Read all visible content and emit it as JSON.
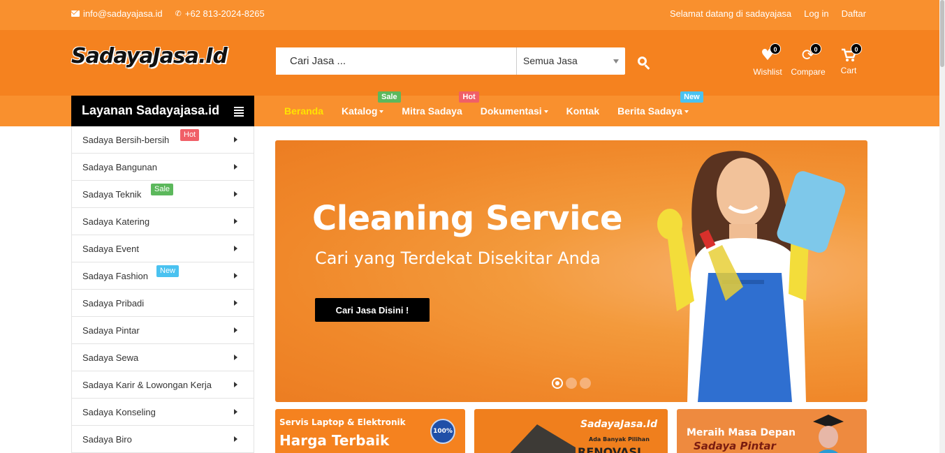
{
  "topbar": {
    "email": "info@sadayajasa.id",
    "phone": "+62 813-2024-8265",
    "welcome": "Selamat datang di sadayajasa",
    "login": "Log in",
    "register": "Daftar"
  },
  "header": {
    "logo": "SadayaJasa.Id",
    "search_placeholder": "Cari Jasa ...",
    "category_select": "Semua Jasa",
    "icons": [
      {
        "label": "Wishlist",
        "count": "0",
        "icon": "heart-icon"
      },
      {
        "label": "Compare",
        "count": "0",
        "icon": "refresh-icon"
      },
      {
        "label": "Cart",
        "count": "0",
        "icon": "cart-icon"
      }
    ]
  },
  "nav": {
    "category_title": "Layanan Sadayajasa.id",
    "items": [
      {
        "label": "Beranda"
      },
      {
        "label": "Katalog",
        "tag": "Sale"
      },
      {
        "label": "Mitra Sadaya",
        "tag": "Hot"
      },
      {
        "label": "Dokumentasi"
      },
      {
        "label": "Kontak"
      },
      {
        "label": "Berita Sadaya",
        "tag": "New"
      }
    ]
  },
  "sidebar": {
    "items": [
      {
        "label": "Sadaya Bersih-bersih",
        "tag": "Hot"
      },
      {
        "label": "Sadaya Bangunan"
      },
      {
        "label": "Sadaya Teknik",
        "tag": "Sale"
      },
      {
        "label": "Sadaya Katering"
      },
      {
        "label": "Sadaya Event"
      },
      {
        "label": "Sadaya Fashion",
        "tag": "New"
      },
      {
        "label": "Sadaya Pribadi"
      },
      {
        "label": "Sadaya Pintar"
      },
      {
        "label": "Sadaya Sewa"
      },
      {
        "label": "Sadaya Karir & Lowongan Kerja"
      },
      {
        "label": "Sadaya Konseling"
      },
      {
        "label": "Sadaya Biro"
      }
    ]
  },
  "banner": {
    "title": "Cleaning Service",
    "subtitle": "Cari yang Terdekat Disekitar Anda",
    "button": "Cari Jasa Disini !"
  },
  "promos": [
    {
      "line1": "Servis Laptop & Elektronik",
      "line2": "Harga Terbaik",
      "badge": "100%"
    },
    {
      "line1": "SadayaJasa.Id",
      "line2": "Ada Banyak Pilihan",
      "line3": "RENOVASI"
    },
    {
      "line1": "Meraih Masa Depan",
      "line2": "Sadaya Pintar"
    }
  ]
}
